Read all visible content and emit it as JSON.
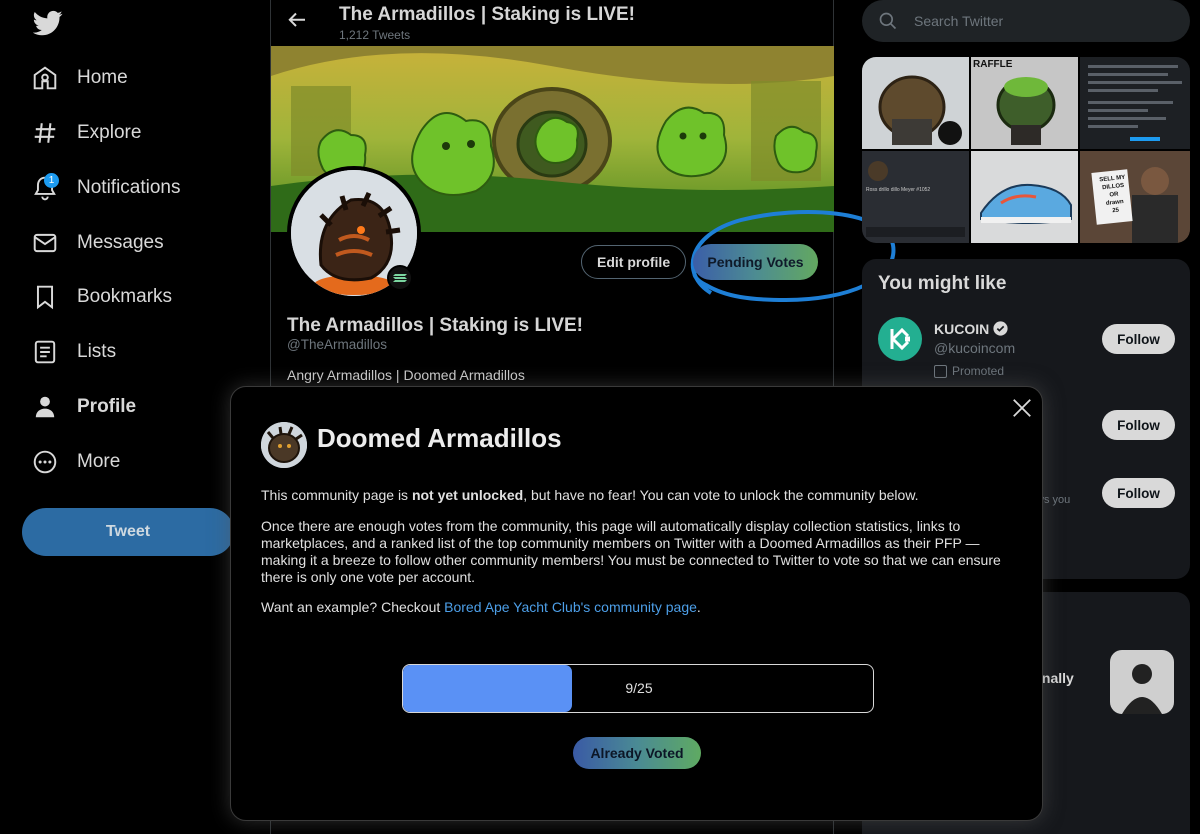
{
  "nav": {
    "items": [
      {
        "label": "Home",
        "icon": "home-icon"
      },
      {
        "label": "Explore",
        "icon": "hashtag-icon"
      },
      {
        "label": "Notifications",
        "icon": "bell-icon",
        "badge": "1"
      },
      {
        "label": "Messages",
        "icon": "envelope-icon"
      },
      {
        "label": "Bookmarks",
        "icon": "bookmark-icon"
      },
      {
        "label": "Lists",
        "icon": "list-icon"
      },
      {
        "label": "Profile",
        "icon": "person-icon"
      },
      {
        "label": "More",
        "icon": "more-circle-icon"
      }
    ],
    "tweet_label": "Tweet"
  },
  "header": {
    "title": "The Armadillos | Staking is LIVE!",
    "tweet_count": "1,212 Tweets"
  },
  "profile": {
    "edit_label": "Edit profile",
    "pending_votes_label": "Pending Votes",
    "name": "The Armadillos | Staking is LIVE!",
    "handle": "@TheArmadillos",
    "bio": "Angry Armadillos | Doomed Armadillos"
  },
  "search": {
    "placeholder": "Search Twitter"
  },
  "media": {
    "raffle_label": "RAFFLE",
    "card_name": "Ross drillo dillo Meyer #1052",
    "sign_lines": [
      "SELL MY",
      "DILLOS",
      "OR",
      "drawn",
      "25"
    ]
  },
  "who_to_follow": {
    "title": "You might like",
    "kucoin_name": "KUCOIN",
    "kucoin_handle": "@kucoincom",
    "promoted": "Promoted",
    "follow_label": "Follow",
    "follows_you_fragment": "ws you"
  },
  "trends": {
    "fragment1": "inally",
    "fragment2": "!"
  },
  "modal": {
    "title": "Doomed Armadillos",
    "p1_before": "This community page is ",
    "p1_bold": "not yet unlocked",
    "p1_after": ", but have no fear! You can vote to unlock the community below.",
    "p2": "Once there are enough votes from the community, this page will automatically display collection statistics, links to marketplaces, and a ranked list of the top community members on Twitter with a Doomed Armadillos as their PFP — making it a breeze to follow other community members! You must be connected to Twitter to vote so that we can ensure there is only one vote per account.",
    "p3_before": "Want an example? Checkout ",
    "p3_link": "Bored Ape Yacht Club's community page",
    "p3_after": ".",
    "votes_current": 9,
    "votes_required": 25,
    "progress_label": "9/25",
    "button_label": "Already Voted"
  },
  "colors": {
    "accent": "#1d9bf0",
    "progress_fill": "#5a91f5",
    "link": "#4d9fe8",
    "tweet_button": "#2c6ba3",
    "annotation_circle": "#1e7fd6"
  }
}
